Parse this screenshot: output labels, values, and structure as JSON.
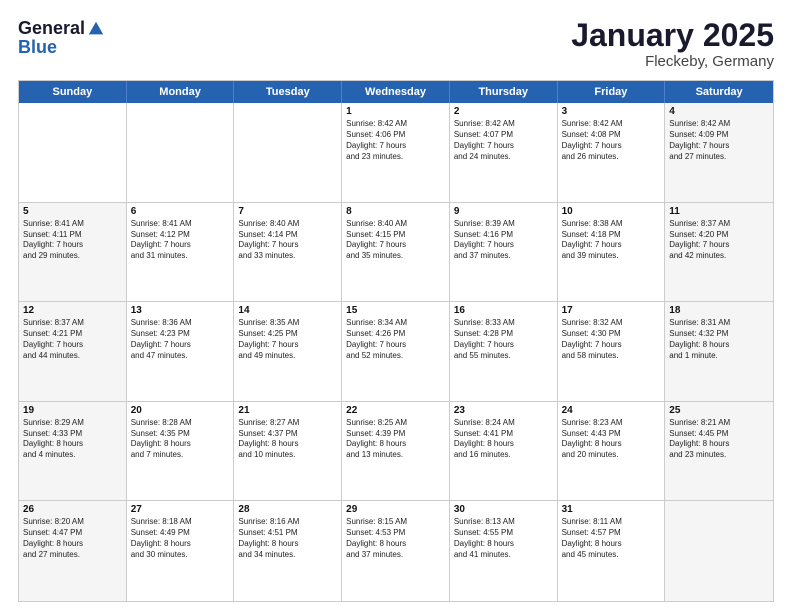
{
  "header": {
    "logo_general": "General",
    "logo_blue": "Blue",
    "month_year": "January 2025",
    "location": "Fleckeby, Germany"
  },
  "weekdays": [
    "Sunday",
    "Monday",
    "Tuesday",
    "Wednesday",
    "Thursday",
    "Friday",
    "Saturday"
  ],
  "weeks": [
    [
      {
        "day": "",
        "text": "",
        "shaded": false
      },
      {
        "day": "",
        "text": "",
        "shaded": false
      },
      {
        "day": "",
        "text": "",
        "shaded": false
      },
      {
        "day": "1",
        "text": "Sunrise: 8:42 AM\nSunset: 4:06 PM\nDaylight: 7 hours\nand 23 minutes.",
        "shaded": false
      },
      {
        "day": "2",
        "text": "Sunrise: 8:42 AM\nSunset: 4:07 PM\nDaylight: 7 hours\nand 24 minutes.",
        "shaded": false
      },
      {
        "day": "3",
        "text": "Sunrise: 8:42 AM\nSunset: 4:08 PM\nDaylight: 7 hours\nand 26 minutes.",
        "shaded": false
      },
      {
        "day": "4",
        "text": "Sunrise: 8:42 AM\nSunset: 4:09 PM\nDaylight: 7 hours\nand 27 minutes.",
        "shaded": true
      }
    ],
    [
      {
        "day": "5",
        "text": "Sunrise: 8:41 AM\nSunset: 4:11 PM\nDaylight: 7 hours\nand 29 minutes.",
        "shaded": true
      },
      {
        "day": "6",
        "text": "Sunrise: 8:41 AM\nSunset: 4:12 PM\nDaylight: 7 hours\nand 31 minutes.",
        "shaded": false
      },
      {
        "day": "7",
        "text": "Sunrise: 8:40 AM\nSunset: 4:14 PM\nDaylight: 7 hours\nand 33 minutes.",
        "shaded": false
      },
      {
        "day": "8",
        "text": "Sunrise: 8:40 AM\nSunset: 4:15 PM\nDaylight: 7 hours\nand 35 minutes.",
        "shaded": false
      },
      {
        "day": "9",
        "text": "Sunrise: 8:39 AM\nSunset: 4:16 PM\nDaylight: 7 hours\nand 37 minutes.",
        "shaded": false
      },
      {
        "day": "10",
        "text": "Sunrise: 8:38 AM\nSunset: 4:18 PM\nDaylight: 7 hours\nand 39 minutes.",
        "shaded": false
      },
      {
        "day": "11",
        "text": "Sunrise: 8:37 AM\nSunset: 4:20 PM\nDaylight: 7 hours\nand 42 minutes.",
        "shaded": true
      }
    ],
    [
      {
        "day": "12",
        "text": "Sunrise: 8:37 AM\nSunset: 4:21 PM\nDaylight: 7 hours\nand 44 minutes.",
        "shaded": true
      },
      {
        "day": "13",
        "text": "Sunrise: 8:36 AM\nSunset: 4:23 PM\nDaylight: 7 hours\nand 47 minutes.",
        "shaded": false
      },
      {
        "day": "14",
        "text": "Sunrise: 8:35 AM\nSunset: 4:25 PM\nDaylight: 7 hours\nand 49 minutes.",
        "shaded": false
      },
      {
        "day": "15",
        "text": "Sunrise: 8:34 AM\nSunset: 4:26 PM\nDaylight: 7 hours\nand 52 minutes.",
        "shaded": false
      },
      {
        "day": "16",
        "text": "Sunrise: 8:33 AM\nSunset: 4:28 PM\nDaylight: 7 hours\nand 55 minutes.",
        "shaded": false
      },
      {
        "day": "17",
        "text": "Sunrise: 8:32 AM\nSunset: 4:30 PM\nDaylight: 7 hours\nand 58 minutes.",
        "shaded": false
      },
      {
        "day": "18",
        "text": "Sunrise: 8:31 AM\nSunset: 4:32 PM\nDaylight: 8 hours\nand 1 minute.",
        "shaded": true
      }
    ],
    [
      {
        "day": "19",
        "text": "Sunrise: 8:29 AM\nSunset: 4:33 PM\nDaylight: 8 hours\nand 4 minutes.",
        "shaded": true
      },
      {
        "day": "20",
        "text": "Sunrise: 8:28 AM\nSunset: 4:35 PM\nDaylight: 8 hours\nand 7 minutes.",
        "shaded": false
      },
      {
        "day": "21",
        "text": "Sunrise: 8:27 AM\nSunset: 4:37 PM\nDaylight: 8 hours\nand 10 minutes.",
        "shaded": false
      },
      {
        "day": "22",
        "text": "Sunrise: 8:25 AM\nSunset: 4:39 PM\nDaylight: 8 hours\nand 13 minutes.",
        "shaded": false
      },
      {
        "day": "23",
        "text": "Sunrise: 8:24 AM\nSunset: 4:41 PM\nDaylight: 8 hours\nand 16 minutes.",
        "shaded": false
      },
      {
        "day": "24",
        "text": "Sunrise: 8:23 AM\nSunset: 4:43 PM\nDaylight: 8 hours\nand 20 minutes.",
        "shaded": false
      },
      {
        "day": "25",
        "text": "Sunrise: 8:21 AM\nSunset: 4:45 PM\nDaylight: 8 hours\nand 23 minutes.",
        "shaded": true
      }
    ],
    [
      {
        "day": "26",
        "text": "Sunrise: 8:20 AM\nSunset: 4:47 PM\nDaylight: 8 hours\nand 27 minutes.",
        "shaded": true
      },
      {
        "day": "27",
        "text": "Sunrise: 8:18 AM\nSunset: 4:49 PM\nDaylight: 8 hours\nand 30 minutes.",
        "shaded": false
      },
      {
        "day": "28",
        "text": "Sunrise: 8:16 AM\nSunset: 4:51 PM\nDaylight: 8 hours\nand 34 minutes.",
        "shaded": false
      },
      {
        "day": "29",
        "text": "Sunrise: 8:15 AM\nSunset: 4:53 PM\nDaylight: 8 hours\nand 37 minutes.",
        "shaded": false
      },
      {
        "day": "30",
        "text": "Sunrise: 8:13 AM\nSunset: 4:55 PM\nDaylight: 8 hours\nand 41 minutes.",
        "shaded": false
      },
      {
        "day": "31",
        "text": "Sunrise: 8:11 AM\nSunset: 4:57 PM\nDaylight: 8 hours\nand 45 minutes.",
        "shaded": false
      },
      {
        "day": "",
        "text": "",
        "shaded": true
      }
    ]
  ]
}
